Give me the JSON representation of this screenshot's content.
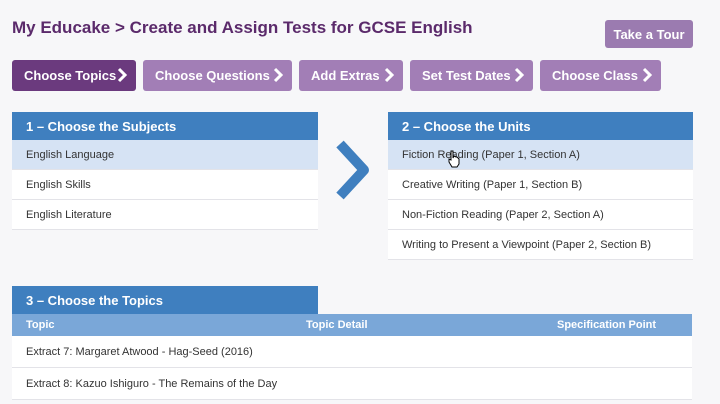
{
  "header": {
    "title": "My Educake > Create and Assign Tests for GCSE English",
    "tour_label": "Take a Tour"
  },
  "steps": [
    {
      "label": "Choose Topics"
    },
    {
      "label": "Choose Questions"
    },
    {
      "label": "Add Extras"
    },
    {
      "label": "Set Test Dates"
    },
    {
      "label": "Choose Class"
    }
  ],
  "subjects": {
    "heading": "1  –  Choose the Subjects",
    "items": [
      "English Language",
      "English Skills",
      "English Literature"
    ],
    "selected_index": 0
  },
  "units": {
    "heading": "2  –  Choose the Units",
    "items": [
      "Fiction Reading (Paper 1, Section A)",
      "Creative Writing (Paper 1, Section B)",
      "Non-Fiction Reading (Paper 2, Section A)",
      "Writing to Present a Viewpoint (Paper 2, Section B)"
    ],
    "selected_index": 0
  },
  "topics": {
    "heading": "3  –  Choose the Topics",
    "columns": [
      "Topic",
      "Topic Detail",
      "Specification Point"
    ],
    "rows": [
      "Extract 7: Margaret Atwood - Hag-Seed (2016)",
      "Extract 8: Kazuo Ishiguro - The Remains of the Day"
    ]
  },
  "colors": {
    "title": "#5b2a6b",
    "step_active": "#6b3a7e",
    "step": "#a27eb6",
    "panel_header": "#3f7fbf",
    "selected_row": "#d6e3f4"
  }
}
